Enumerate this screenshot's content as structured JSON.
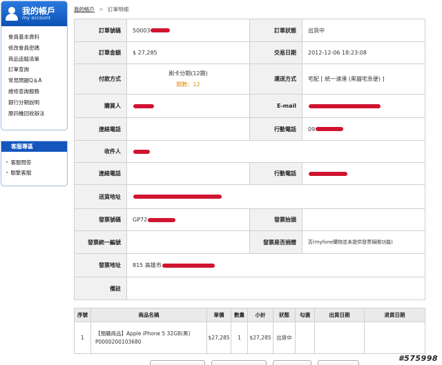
{
  "sidebar": {
    "title": "我的帳戶",
    "subtitle": "my account",
    "menu": [
      "會員基本資料",
      "修改會員密碼",
      "商品追蹤清單",
      "訂單查詢",
      "常見問題Q＆A",
      "維修查詢服務",
      "銀行分期說明",
      "廢四機回收辦法"
    ]
  },
  "service": {
    "title": "客服專區",
    "items": [
      "客服問答",
      "聯繫客服"
    ]
  },
  "breadcrumb": {
    "home": "我的帳戶",
    "separator": ">",
    "current": "訂單明細"
  },
  "order": {
    "labels": {
      "order_no": "訂單號碼",
      "status": "訂單狀態",
      "amount": "訂單金額",
      "trade_date": "交易日期",
      "payment": "付款方式",
      "shipping": "運送方式",
      "buyer": "購買人",
      "email": "E-mail",
      "phone": "連絡電話",
      "mobile": "行動電話",
      "receiver": "收件人",
      "phone2": "連絡電話",
      "mobile2": "行動電話",
      "address": "送貨地址",
      "invoice_no": "發票號碼",
      "invoice_title": "發票抬頭",
      "tax_id": "發票統一編號",
      "donate": "發票是否捐贈",
      "invoice_addr": "發票地址",
      "remark": "備註"
    },
    "values": {
      "order_no": "50003",
      "status": "出貨中",
      "amount": "$ 27,285",
      "trade_date": "2012-12-06 18:23:08",
      "payment_method": "刷卡分期(12期)",
      "installments": "期數：12",
      "shipping": "宅配 [ 統一速達 (黑貓宅急便) ]",
      "buyer": "",
      "email": "",
      "phone": "",
      "mobile": "09",
      "receiver": "",
      "phone2": "",
      "mobile2": "",
      "address": "",
      "invoice_no": "GP72",
      "invoice_title": "",
      "tax_id": "",
      "donate": "否(myfone購物並未提供發票捐贈功能)",
      "invoice_addr": "815 高雄市",
      "remark": ""
    }
  },
  "items": {
    "headers": [
      "序號",
      "商品名稱",
      "單價",
      "數量",
      "小計",
      "狀態",
      "勾選",
      "出貨日期",
      "退貨日期"
    ],
    "rows": [
      {
        "seq": "1",
        "name": "【預購商品】Apple iPhone 5 32GB(黑)",
        "code": "P0000200103680",
        "price": "$27,285",
        "qty": "1",
        "subtotal": "$27,285",
        "status": "出貨中",
        "check": "",
        "ship_date": "",
        "return_date": ""
      }
    ]
  },
  "buttons": [
    "",
    "",
    "",
    ""
  ],
  "watermark": "#575998",
  "colors": {
    "accent": "#1456bd",
    "pink": "#c8386a",
    "orange": "#e08a00",
    "redaction": "#d0132f"
  }
}
